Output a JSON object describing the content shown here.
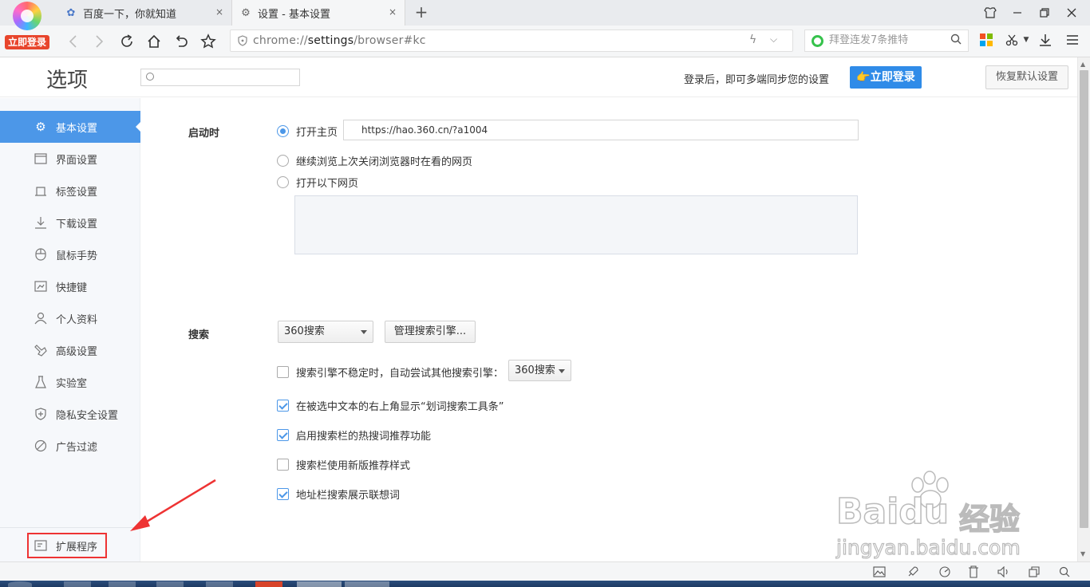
{
  "browser": {
    "login_badge": "立即登录",
    "tabs": [
      {
        "title": "百度一下，你就知道",
        "active": false
      },
      {
        "title": "设置 - 基本设置",
        "active": true
      }
    ],
    "new_tab": "+",
    "close_glyph": "×",
    "address": {
      "prefix": "chrome://",
      "host": "settings",
      "path": "/browser#kc"
    },
    "search_placeholder": "拜登连发7条推特"
  },
  "settings": {
    "title": "选项",
    "search_placeholder": "",
    "sync_text": "登录后，即可多端同步您的设置",
    "login_button": "👉立即登录",
    "reset_button": "恢复默认设置",
    "sidebar": [
      {
        "label": "基本设置",
        "icon": "gear-icon",
        "active": true
      },
      {
        "label": "界面设置",
        "icon": "window-icon",
        "active": false
      },
      {
        "label": "标签设置",
        "icon": "tab-icon",
        "active": false
      },
      {
        "label": "下载设置",
        "icon": "download-icon",
        "active": false
      },
      {
        "label": "鼠标手势",
        "icon": "mouse-icon",
        "active": false
      },
      {
        "label": "快捷键",
        "icon": "shortcut-icon",
        "active": false
      },
      {
        "label": "个人资料",
        "icon": "user-icon",
        "active": false
      },
      {
        "label": "高级设置",
        "icon": "advanced-icon",
        "active": false
      },
      {
        "label": "实验室",
        "icon": "flask-icon",
        "active": false
      },
      {
        "label": "隐私安全设置",
        "icon": "shield-icon",
        "active": false
      },
      {
        "label": "广告过滤",
        "icon": "block-icon",
        "active": false
      }
    ],
    "extensions_label": "扩展程序",
    "startup": {
      "label": "启动时",
      "options": [
        {
          "label": "打开主页",
          "checked": true
        },
        {
          "label": "继续浏览上次关闭浏览器时在看的网页",
          "checked": false
        },
        {
          "label": "打开以下网页",
          "checked": false
        }
      ],
      "homepage_url": "https://hao.360.cn/?a1004"
    },
    "search": {
      "label": "搜索",
      "engine": "360搜索",
      "manage_button": "管理搜索引擎...",
      "fallback_label": "搜索引擎不稳定时，自动尝试其他搜索引擎：",
      "fallback_engine": "360搜索",
      "checks": [
        {
          "label": "搜索引擎不稳定时，自动尝试其他搜索引擎：",
          "checked": false
        },
        {
          "label": "在被选中文本的右上角显示“划词搜索工具条”",
          "checked": true
        },
        {
          "label": "启用搜索栏的热搜词推荐功能",
          "checked": true
        },
        {
          "label": "搜索栏使用新版推荐样式",
          "checked": false
        },
        {
          "label": "地址栏搜索展示联想词",
          "checked": true
        }
      ]
    }
  },
  "watermark": {
    "brand": "Baidu",
    "suffix": "经验",
    "site": "jingyan.baidu.com"
  },
  "colors": {
    "accent": "#4c97e8",
    "login_button": "#2f8be8",
    "badge": "#e8452c",
    "annotation": "#e33"
  }
}
